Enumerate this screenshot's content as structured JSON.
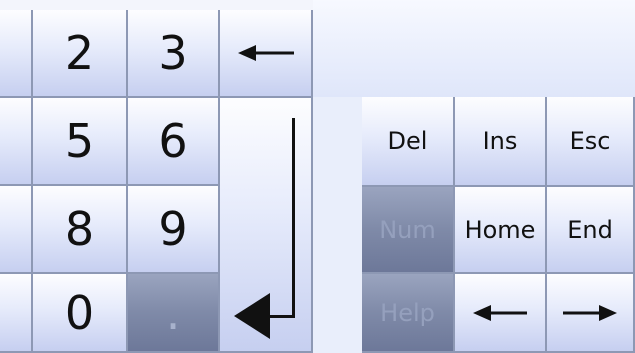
{
  "numpad": {
    "row1": [
      "2",
      "3"
    ],
    "row2": [
      "5",
      "6"
    ],
    "row3": [
      "8",
      "9"
    ],
    "row4": [
      "0",
      "."
    ]
  },
  "right_panel": {
    "row1": [
      "Del",
      "Ins",
      "Esc"
    ],
    "row2": [
      "Num",
      "Home",
      "End"
    ],
    "row3": [
      "Help"
    ]
  },
  "icons": {
    "backspace": "left-arrow-icon",
    "enter": "enter-arrow-icon",
    "left": "left-arrow-icon",
    "right": "right-arrow-icon"
  }
}
